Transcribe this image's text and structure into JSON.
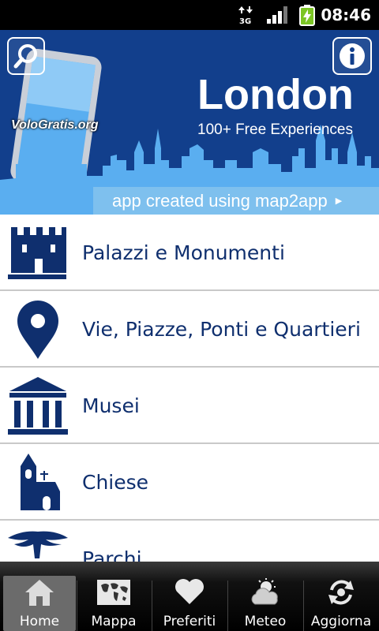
{
  "status_bar": {
    "network": "3G",
    "time": "08:46"
  },
  "header": {
    "title": "London",
    "subtitle": "100+ Free Experiences",
    "brand": "VoloGratis.org",
    "credit": "app created using map2app",
    "search_icon": "search-icon",
    "info_icon": "info-icon",
    "colors": {
      "header_bg": "#123f8c",
      "skyline": "#5aaef0",
      "credit_bar": "#7ec0ee"
    }
  },
  "categories": [
    {
      "label": "Palazzi e Monumenti",
      "icon": "castle-icon"
    },
    {
      "label": "Vie, Piazze, Ponti e Quartieri",
      "icon": "map-pin-icon"
    },
    {
      "label": "Musei",
      "icon": "museum-icon"
    },
    {
      "label": "Chiese",
      "icon": "church-icon"
    },
    {
      "label": "Parchi",
      "icon": "tree-icon"
    }
  ],
  "tabbar": {
    "tabs": [
      {
        "label": "Home",
        "icon": "home-icon",
        "active": true
      },
      {
        "label": "Mappa",
        "icon": "world-map-icon",
        "active": false
      },
      {
        "label": "Preferiti",
        "icon": "heart-icon",
        "active": false
      },
      {
        "label": "Meteo",
        "icon": "weather-icon",
        "active": false
      },
      {
        "label": "Aggiorna",
        "icon": "refresh-icon",
        "active": false
      }
    ]
  },
  "colors": {
    "accent": "#0f2f6e",
    "list_text": "#0f2f6e",
    "divider": "#c9c9c9"
  }
}
